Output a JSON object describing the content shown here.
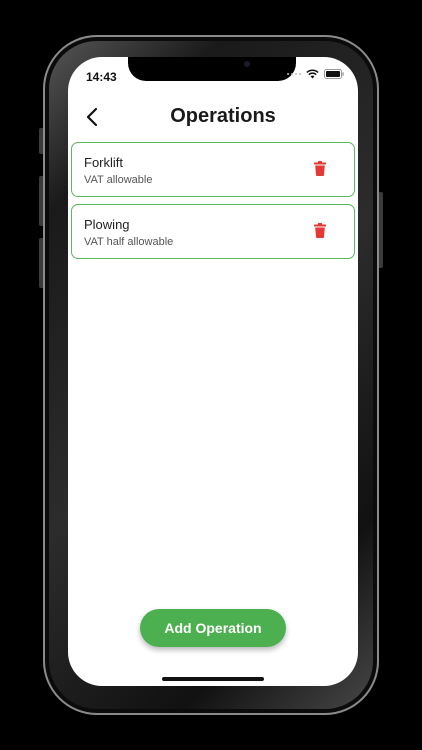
{
  "status_bar": {
    "time": "14:43"
  },
  "header": {
    "title": "Operations"
  },
  "operations": [
    {
      "name": "Forklift",
      "vat": "VAT allowable"
    },
    {
      "name": "Plowing",
      "vat": "VAT half allowable"
    }
  ],
  "actions": {
    "add_label": "Add Operation"
  },
  "colors": {
    "accent": "#4caf50",
    "border": "#5cb85c",
    "delete": "#e53935"
  },
  "icons": {
    "back": "chevron-left-icon",
    "delete": "trash-icon"
  }
}
